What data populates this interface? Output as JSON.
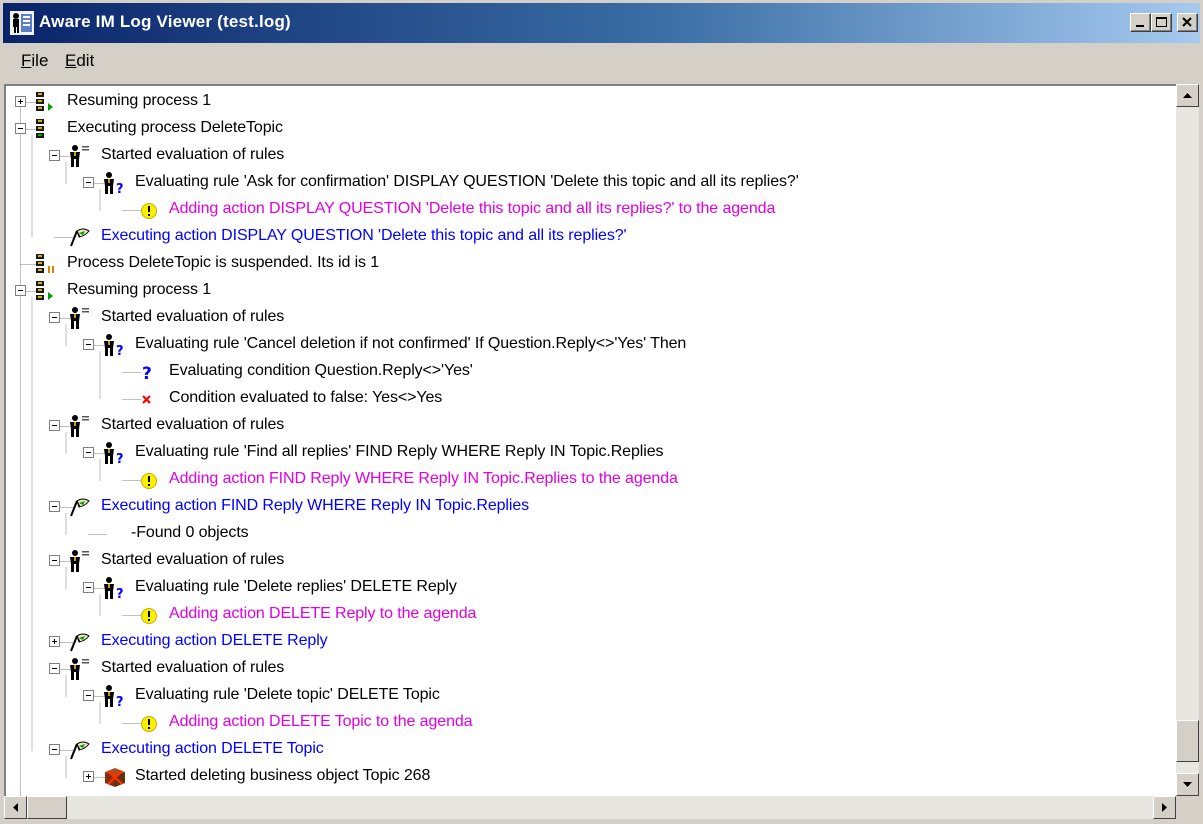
{
  "window": {
    "title": "Aware IM Log Viewer (test.log)"
  },
  "menu": {
    "items": [
      {
        "label": "File",
        "hotkey": "F",
        "rest": "ile"
      },
      {
        "label": "Edit",
        "hotkey": "E",
        "rest": "dit"
      }
    ]
  },
  "colors": {
    "titlebar_start": "#0a246a",
    "titlebar_end": "#a6caf0",
    "text_default": "#000000",
    "text_action": "#0000ff",
    "text_agenda": "#e000e0"
  },
  "tree": {
    "rows": [
      {
        "level": 0,
        "expander": "plus",
        "icon": "process-resume-icon",
        "color": "black",
        "text": "Resuming process 1"
      },
      {
        "level": 0,
        "expander": "minus",
        "icon": "process-icon",
        "color": "black",
        "text": "Executing process DeleteTopic"
      },
      {
        "level": 1,
        "expander": "minus",
        "icon": "rules-evaluation-icon",
        "color": "black",
        "text": "Started evaluation of rules"
      },
      {
        "level": 2,
        "expander": "minus",
        "icon": "rule-question-icon",
        "color": "black",
        "text": "Evaluating rule 'Ask for confirmation' DISPLAY QUESTION 'Delete this topic and all its replies?'"
      },
      {
        "level": 3,
        "expander": "none",
        "icon": "warning-icon",
        "color": "magenta",
        "text": "Adding action DISPLAY QUESTION 'Delete this topic and all its replies?' to the agenda"
      },
      {
        "level": 1,
        "expander": "none",
        "icon": "flag-icon",
        "color": "blue",
        "text": "Executing action DISPLAY QUESTION 'Delete this topic and all its replies?'"
      },
      {
        "level": 0,
        "expander": "none",
        "icon": "process-suspended-icon",
        "color": "black",
        "text": "Process DeleteTopic is suspended. Its id is 1"
      },
      {
        "level": 0,
        "expander": "minus",
        "icon": "process-resume-icon",
        "color": "black",
        "text": "Resuming process 1"
      },
      {
        "level": 1,
        "expander": "minus",
        "icon": "rules-evaluation-icon",
        "color": "black",
        "text": "Started evaluation of rules"
      },
      {
        "level": 2,
        "expander": "minus",
        "icon": "rule-question-icon",
        "color": "black",
        "text": "Evaluating rule 'Cancel deletion if not confirmed' If Question.Reply<>'Yes' Then"
      },
      {
        "level": 3,
        "expander": "none",
        "icon": "question-icon",
        "color": "black",
        "text": "Evaluating condition Question.Reply<>'Yes'"
      },
      {
        "level": 3,
        "expander": "none",
        "icon": "false-x-icon",
        "color": "black",
        "text": "Condition evaluated to false: Yes<>Yes"
      },
      {
        "level": 1,
        "expander": "minus",
        "icon": "rules-evaluation-icon",
        "color": "black",
        "text": "Started evaluation of rules"
      },
      {
        "level": 2,
        "expander": "minus",
        "icon": "rule-question-icon",
        "color": "black",
        "text": "Evaluating rule 'Find all replies' FIND Reply WHERE Reply IN Topic.Replies"
      },
      {
        "level": 3,
        "expander": "none",
        "icon": "warning-icon",
        "color": "magenta",
        "text": "Adding action FIND Reply WHERE Reply IN Topic.Replies to the agenda"
      },
      {
        "level": 1,
        "expander": "minus",
        "icon": "flag-icon",
        "color": "blue",
        "text": "Executing action FIND Reply WHERE Reply IN Topic.Replies"
      },
      {
        "level": 2,
        "expander": "none",
        "icon": "none",
        "color": "black",
        "text": "-Found 0 objects"
      },
      {
        "level": 1,
        "expander": "minus",
        "icon": "rules-evaluation-icon",
        "color": "black",
        "text": "Started evaluation of rules"
      },
      {
        "level": 2,
        "expander": "minus",
        "icon": "rule-question-icon",
        "color": "black",
        "text": "Evaluating rule 'Delete replies' DELETE Reply"
      },
      {
        "level": 3,
        "expander": "none",
        "icon": "warning-icon",
        "color": "magenta",
        "text": "Adding action DELETE Reply to the agenda"
      },
      {
        "level": 1,
        "expander": "plus",
        "icon": "flag-icon",
        "color": "blue",
        "text": "Executing action DELETE Reply"
      },
      {
        "level": 1,
        "expander": "minus",
        "icon": "rules-evaluation-icon",
        "color": "black",
        "text": "Started evaluation of rules"
      },
      {
        "level": 2,
        "expander": "minus",
        "icon": "rule-question-icon",
        "color": "black",
        "text": "Evaluating rule 'Delete topic' DELETE Topic"
      },
      {
        "level": 3,
        "expander": "none",
        "icon": "warning-icon",
        "color": "magenta",
        "text": "Adding action DELETE Topic to the agenda"
      },
      {
        "level": 1,
        "expander": "minus",
        "icon": "flag-icon",
        "color": "blue",
        "text": "Executing action DELETE Topic"
      },
      {
        "level": 2,
        "expander": "plus",
        "icon": "delete-object-icon",
        "color": "black",
        "text": "Started deleting business object Topic 268"
      }
    ]
  }
}
